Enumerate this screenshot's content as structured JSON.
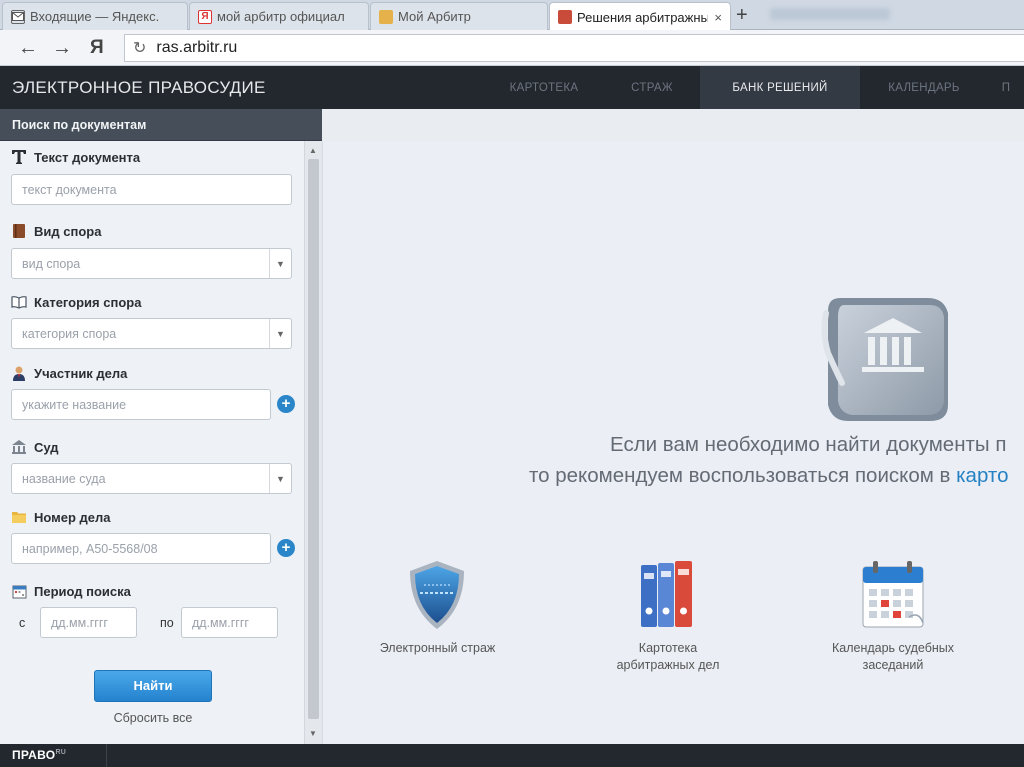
{
  "browser": {
    "tabs": [
      {
        "label": "Входящие — Яндекс.",
        "favicon": "mail-icon",
        "active": false
      },
      {
        "label": "мой арбитр официал",
        "favicon": "yandex-icon",
        "active": false
      },
      {
        "label": "Мой Арбитр",
        "favicon": "emblem-icon",
        "active": false
      },
      {
        "label": "Решения арбитражны",
        "favicon": "emblem-icon",
        "active": true,
        "close": "×"
      }
    ],
    "new_tab": "+",
    "nav_back": "←",
    "nav_forward": "→",
    "yandex_logo": "Я",
    "url": "ras.arbitr.ru"
  },
  "header": {
    "title": "ЭЛЕКТРОННОЕ ПРАВОСУДИЕ",
    "nav": [
      {
        "label": "КАРТОТЕКА",
        "active": false
      },
      {
        "label": "СТРАЖ",
        "active": false
      },
      {
        "label": "БАНК РЕШЕНИЙ",
        "active": true
      },
      {
        "label": "КАЛЕНДАРЬ",
        "active": false
      },
      {
        "label": "П",
        "active": false
      }
    ]
  },
  "sidebar": {
    "title": "Поиск по документам",
    "fields": {
      "text": {
        "label": "Текст документа",
        "placeholder": "текст документа",
        "icon": "text-icon"
      },
      "dispute_type": {
        "label": "Вид спора",
        "value": "вид спора",
        "icon": "book-icon"
      },
      "dispute_category": {
        "label": "Категория спора",
        "value": "категория спора",
        "icon": "open-book-icon"
      },
      "participant": {
        "label": "Участник дела",
        "placeholder": "укажите название",
        "icon": "person-icon"
      },
      "court": {
        "label": "Суд",
        "value": "название суда",
        "icon": "court-building-icon"
      },
      "case_number": {
        "label": "Номер дела",
        "placeholder": "например, А50-5568/08",
        "icon": "folder-icon"
      },
      "period": {
        "label": "Период поиска",
        "from_label": "с",
        "to_label": "по",
        "from_placeholder": "дд.мм.гггг",
        "to_placeholder": "дд.мм.гггг",
        "icon": "calendar-icon"
      }
    },
    "search_button": "Найти",
    "reset_link": "Сбросить все"
  },
  "main": {
    "message_line1": "Если вам необходимо найти документы п",
    "message_line2_prefix": "то рекомендуем воспользоваться поиском в ",
    "message_line2_link": "карто",
    "services": [
      {
        "line1": "Электронный страж",
        "line2": "",
        "icon": "shield-icon"
      },
      {
        "line1": "Картотека",
        "line2": "арбитражных дел",
        "icon": "binders-icon"
      },
      {
        "line1": "Календарь судебных",
        "line2": "заседаний",
        "icon": "calendar-icon"
      }
    ]
  },
  "footer": {
    "brand": "ПРАВО",
    "brand_suffix": "RU"
  },
  "colors": {
    "header_bg": "#23272e",
    "accent": "#2583cf",
    "link": "#2581c4"
  }
}
